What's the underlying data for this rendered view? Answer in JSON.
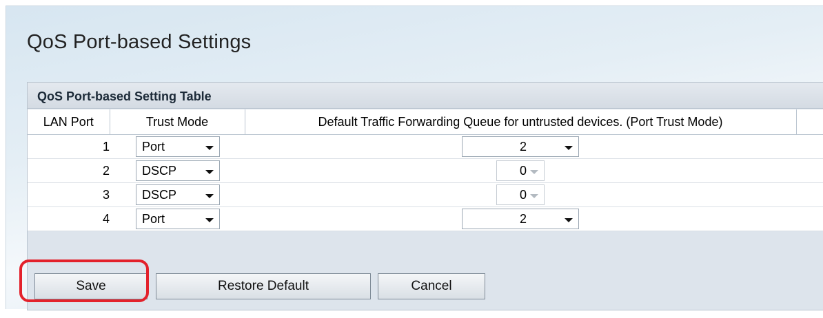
{
  "page": {
    "title": "QoS Port-based Settings"
  },
  "table": {
    "caption": "QoS Port-based Setting Table",
    "columns": [
      "LAN Port",
      "Trust Mode",
      "Default Traffic Forwarding Queue for untrusted devices. (Port Trust Mode)"
    ],
    "rows": [
      {
        "port": "1",
        "trust_mode": "Port",
        "queue": "2",
        "queue_enabled": true
      },
      {
        "port": "2",
        "trust_mode": "DSCP",
        "queue": "0",
        "queue_enabled": false
      },
      {
        "port": "3",
        "trust_mode": "DSCP",
        "queue": "0",
        "queue_enabled": false
      },
      {
        "port": "4",
        "trust_mode": "Port",
        "queue": "2",
        "queue_enabled": true
      }
    ]
  },
  "buttons": {
    "save": "Save",
    "restore_default": "Restore Default",
    "cancel": "Cancel"
  },
  "colors": {
    "highlight": "#e3212b",
    "caption_bg": "#d4dbe3"
  }
}
